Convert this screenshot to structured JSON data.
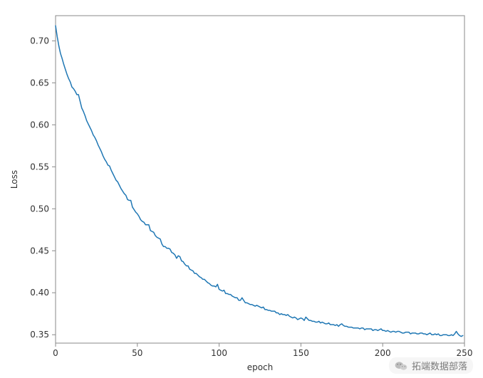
{
  "chart_data": {
    "type": "line",
    "title": "",
    "xlabel": "epoch",
    "ylabel": "Loss",
    "xlim": [
      0,
      250
    ],
    "ylim": [
      0.34,
      0.73
    ],
    "x_ticks": [
      0,
      50,
      100,
      150,
      200,
      250
    ],
    "y_ticks": [
      0.35,
      0.4,
      0.45,
      0.5,
      0.55,
      0.6,
      0.65,
      0.7
    ],
    "series": [
      {
        "name": "loss",
        "color": "#1f77b4",
        "x": [
          0,
          1,
          2,
          3,
          4,
          5,
          6,
          7,
          8,
          9,
          10,
          11,
          12,
          13,
          14,
          15,
          16,
          17,
          18,
          19,
          20,
          21,
          22,
          23,
          24,
          25,
          26,
          27,
          28,
          29,
          30,
          31,
          32,
          33,
          34,
          35,
          36,
          37,
          38,
          39,
          40,
          41,
          42,
          43,
          44,
          45,
          46,
          47,
          48,
          49,
          50,
          51,
          52,
          53,
          54,
          55,
          56,
          57,
          58,
          59,
          60,
          61,
          62,
          63,
          64,
          65,
          66,
          67,
          68,
          69,
          70,
          71,
          72,
          73,
          74,
          75,
          76,
          77,
          78,
          79,
          80,
          81,
          82,
          83,
          84,
          85,
          86,
          87,
          88,
          89,
          90,
          91,
          92,
          93,
          94,
          95,
          96,
          97,
          98,
          99,
          100,
          101,
          102,
          103,
          104,
          105,
          106,
          107,
          108,
          109,
          110,
          111,
          112,
          113,
          114,
          115,
          116,
          117,
          118,
          119,
          120,
          121,
          122,
          123,
          124,
          125,
          126,
          127,
          128,
          129,
          130,
          131,
          132,
          133,
          134,
          135,
          136,
          137,
          138,
          139,
          140,
          141,
          142,
          143,
          144,
          145,
          146,
          147,
          148,
          149,
          150,
          151,
          152,
          153,
          154,
          155,
          156,
          157,
          158,
          159,
          160,
          161,
          162,
          163,
          164,
          165,
          166,
          167,
          168,
          169,
          170,
          171,
          172,
          173,
          174,
          175,
          176,
          177,
          178,
          179,
          180,
          181,
          182,
          183,
          184,
          185,
          186,
          187,
          188,
          189,
          190,
          191,
          192,
          193,
          194,
          195,
          196,
          197,
          198,
          199,
          200,
          201,
          202,
          203,
          204,
          205,
          206,
          207,
          208,
          209,
          210,
          211,
          212,
          213,
          214,
          215,
          216,
          217,
          218,
          219,
          220,
          221,
          222,
          223,
          224,
          225,
          226,
          227,
          228,
          229,
          230,
          231,
          232,
          233,
          234,
          235,
          236,
          237,
          238,
          239,
          240,
          241,
          242,
          243,
          244,
          245,
          246,
          247,
          248,
          249
        ],
        "values": [
          0.718,
          0.705,
          0.694,
          0.685,
          0.679,
          0.672,
          0.666,
          0.66,
          0.655,
          0.651,
          0.645,
          0.643,
          0.64,
          0.636,
          0.636,
          0.628,
          0.62,
          0.616,
          0.611,
          0.605,
          0.601,
          0.597,
          0.593,
          0.588,
          0.585,
          0.581,
          0.576,
          0.572,
          0.568,
          0.563,
          0.559,
          0.556,
          0.552,
          0.551,
          0.546,
          0.542,
          0.538,
          0.534,
          0.532,
          0.528,
          0.524,
          0.521,
          0.518,
          0.516,
          0.511,
          0.51,
          0.51,
          0.502,
          0.499,
          0.496,
          0.494,
          0.491,
          0.487,
          0.485,
          0.484,
          0.481,
          0.481,
          0.481,
          0.474,
          0.473,
          0.472,
          0.468,
          0.466,
          0.465,
          0.464,
          0.458,
          0.455,
          0.455,
          0.453,
          0.453,
          0.452,
          0.448,
          0.447,
          0.445,
          0.441,
          0.444,
          0.443,
          0.438,
          0.437,
          0.434,
          0.432,
          0.432,
          0.428,
          0.427,
          0.426,
          0.423,
          0.423,
          0.421,
          0.419,
          0.418,
          0.416,
          0.416,
          0.414,
          0.412,
          0.411,
          0.409,
          0.408,
          0.408,
          0.407,
          0.41,
          0.404,
          0.403,
          0.402,
          0.403,
          0.399,
          0.399,
          0.398,
          0.398,
          0.396,
          0.395,
          0.394,
          0.394,
          0.391,
          0.391,
          0.394,
          0.391,
          0.388,
          0.388,
          0.387,
          0.386,
          0.386,
          0.385,
          0.384,
          0.385,
          0.384,
          0.383,
          0.382,
          0.383,
          0.38,
          0.38,
          0.379,
          0.379,
          0.378,
          0.378,
          0.378,
          0.376,
          0.376,
          0.374,
          0.375,
          0.374,
          0.374,
          0.373,
          0.374,
          0.372,
          0.371,
          0.37,
          0.371,
          0.37,
          0.368,
          0.369,
          0.37,
          0.369,
          0.367,
          0.371,
          0.369,
          0.367,
          0.367,
          0.366,
          0.366,
          0.365,
          0.365,
          0.366,
          0.364,
          0.365,
          0.364,
          0.363,
          0.363,
          0.364,
          0.362,
          0.362,
          0.362,
          0.361,
          0.362,
          0.36,
          0.362,
          0.363,
          0.361,
          0.36,
          0.36,
          0.359,
          0.359,
          0.359,
          0.358,
          0.358,
          0.358,
          0.358,
          0.357,
          0.358,
          0.358,
          0.356,
          0.357,
          0.357,
          0.357,
          0.357,
          0.355,
          0.356,
          0.356,
          0.355,
          0.356,
          0.357,
          0.355,
          0.355,
          0.354,
          0.355,
          0.354,
          0.353,
          0.354,
          0.354,
          0.353,
          0.354,
          0.354,
          0.353,
          0.352,
          0.352,
          0.353,
          0.353,
          0.353,
          0.351,
          0.352,
          0.352,
          0.352,
          0.351,
          0.351,
          0.352,
          0.352,
          0.351,
          0.351,
          0.35,
          0.351,
          0.352,
          0.35,
          0.35,
          0.351,
          0.35,
          0.351,
          0.349,
          0.349,
          0.35,
          0.35,
          0.35,
          0.349,
          0.349,
          0.35,
          0.349,
          0.351,
          0.354,
          0.351,
          0.349,
          0.348,
          0.349
        ]
      }
    ]
  },
  "watermark": {
    "label": "拓端数据部落",
    "icon_name": "wechat-icon"
  }
}
